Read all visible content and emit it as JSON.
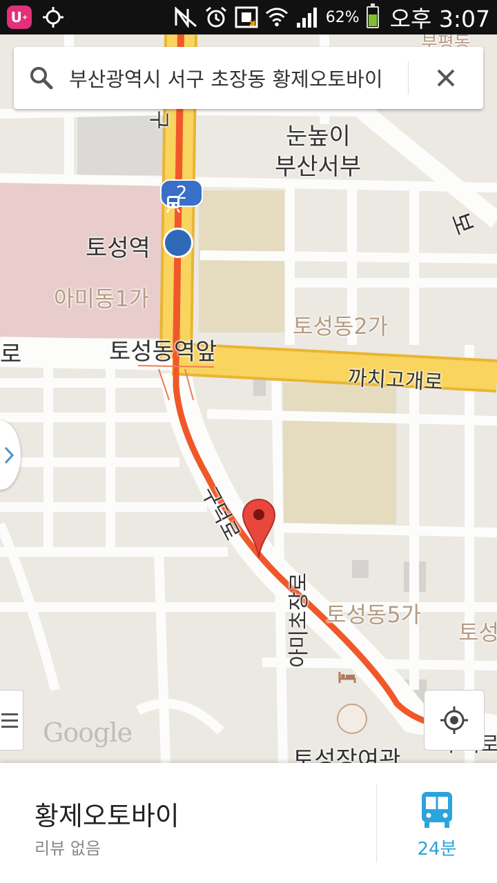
{
  "status_bar": {
    "carrier_icon": "u-plus-logo",
    "battery_percent": "62%",
    "battery_level": 0.62,
    "time": "오후 3:07",
    "icons": [
      "gps-icon",
      "nfc-icon",
      "alarm-icon",
      "download-icon",
      "wifi-icon",
      "signal-icon",
      "battery-icon"
    ]
  },
  "search": {
    "query": "부산광역시 서구 초장동 황제오토바이"
  },
  "map": {
    "labels": {
      "area_nunnopi": "눈높이",
      "area_busan_seobu": "부산서부",
      "station": "토성역",
      "area_amidong1": "아미동1가",
      "area_toseongdong2": "토성동2가",
      "intersection": "토성동역앞",
      "road_kkachigogae": "까치고개로",
      "road_gudeok": "구덕로",
      "road_amichojang": "아미초장로",
      "area_toseongdong5": "토성동5가",
      "hotel": "토성장여관",
      "edge_ro_left": "로",
      "edge_toseong_right": "토성",
      "edge_gudeok_top": "구",
      "edge_gudeok_bottom": "구덕로",
      "edge_bo_right": "보",
      "edge_top_right": "부평동"
    },
    "route_number": "2",
    "logo": "Google",
    "colors": {
      "route": "#f0582a",
      "major_road": "#f7cf5a",
      "pin": "#e8473e"
    }
  },
  "place_card": {
    "name": "황제오토바이",
    "subtitle": "리뷰 없음",
    "transit_time": "24분",
    "accent": "#2ba3dc"
  }
}
